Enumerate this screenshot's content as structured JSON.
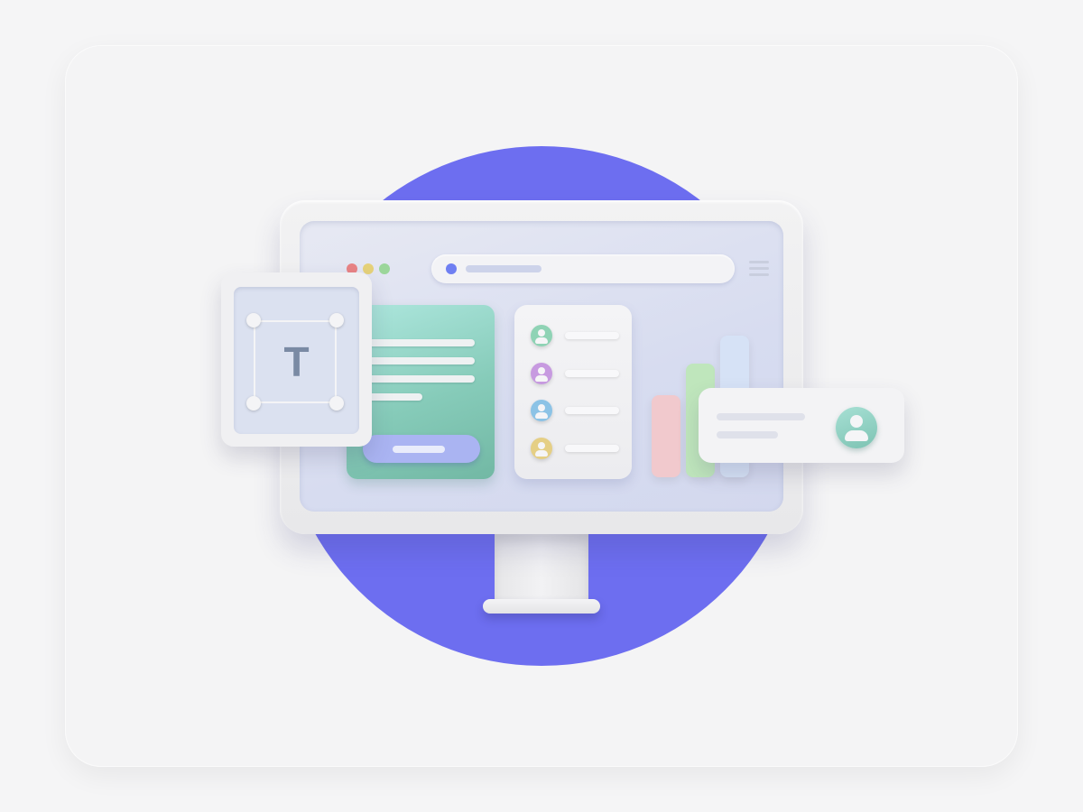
{
  "colors": {
    "background": "#f5f5f6",
    "circle": "#6d6ef0",
    "window_red": "#e88385",
    "window_yellow": "#e5d179",
    "window_green": "#9bd69a",
    "url_dot": "#6f7ff2",
    "bar_pink": "#f1c9cd",
    "bar_green": "#bfe6bc",
    "bar_blue": "#d6e2f6"
  },
  "text_tool": {
    "letter": "T",
    "icon": "text-tool-icon"
  },
  "contact_list": {
    "avatars": [
      {
        "color": "#8fd3b5",
        "icon": "user-icon"
      },
      {
        "color": "#c79ae0",
        "icon": "user-icon"
      },
      {
        "color": "#8cc3e6",
        "icon": "user-icon"
      },
      {
        "color": "#e5cf85",
        "icon": "user-icon"
      }
    ]
  },
  "bar_chart": {
    "values": [
      0.65,
      0.9,
      1.12
    ]
  }
}
